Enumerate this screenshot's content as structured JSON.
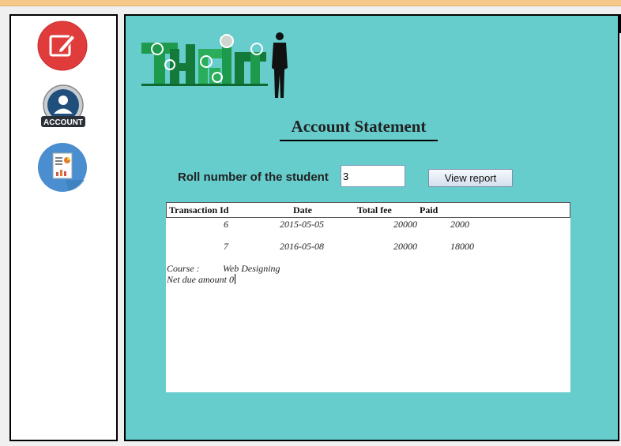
{
  "sidebar": {
    "items": [
      {
        "name": "edit-icon"
      },
      {
        "name": "account-icon",
        "badge_text": "ACCOUNT"
      },
      {
        "name": "report-icon"
      }
    ]
  },
  "main": {
    "title": "Account Statement",
    "roll_label": "Roll number of the student",
    "roll_value": "3",
    "view_button": "View report",
    "table": {
      "headers": [
        "Transaction Id",
        "Date",
        "Total fee",
        "Paid"
      ],
      "rows": [
        [
          "6",
          "2015-05-05",
          "20000",
          "2000"
        ],
        [
          "7",
          "2016-05-08",
          "20000",
          "18000"
        ]
      ],
      "course_label": "Course  :",
      "course_value": "Web Designing",
      "net_due": "Net due amount 0"
    }
  },
  "colors": {
    "panel_bg": "#66cccc",
    "accent_red": "#e23b3b",
    "accent_blue": "#4a8ed0"
  }
}
